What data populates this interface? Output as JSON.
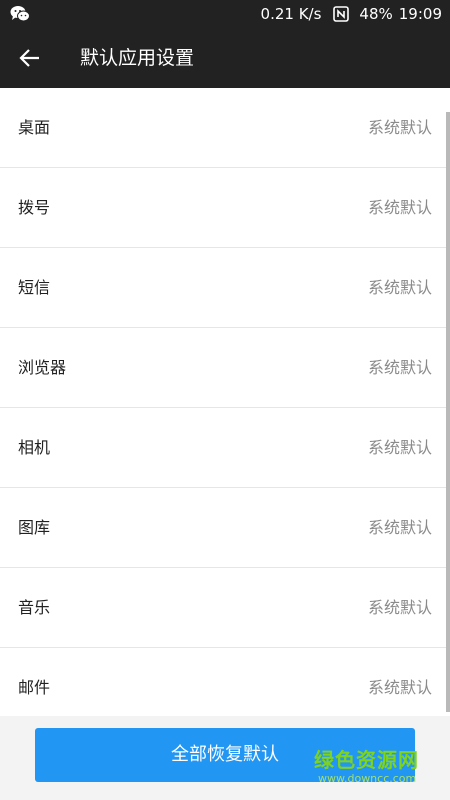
{
  "status_bar": {
    "network_speed": "0.21 K/s",
    "battery": "48%",
    "time": "19:09",
    "left_icon": "wechat-icon",
    "nfc_icon": "nfc-icon"
  },
  "app_bar": {
    "back_icon": "arrow-left-icon",
    "title": "默认应用设置"
  },
  "list": {
    "items": [
      {
        "label": "桌面",
        "value": "系统默认"
      },
      {
        "label": "拨号",
        "value": "系统默认"
      },
      {
        "label": "短信",
        "value": "系统默认"
      },
      {
        "label": "浏览器",
        "value": "系统默认"
      },
      {
        "label": "相机",
        "value": "系统默认"
      },
      {
        "label": "图库",
        "value": "系统默认"
      },
      {
        "label": "音乐",
        "value": "系统默认"
      },
      {
        "label": "邮件",
        "value": "系统默认"
      }
    ]
  },
  "bottom": {
    "restore_button_label": "全部恢复默认"
  },
  "watermark": {
    "main": "绿色资源网",
    "sub": "www.downcc.com"
  },
  "colors": {
    "app_bar_bg": "#222222",
    "accent": "#2196f3",
    "watermark_green": "#7ed321"
  }
}
